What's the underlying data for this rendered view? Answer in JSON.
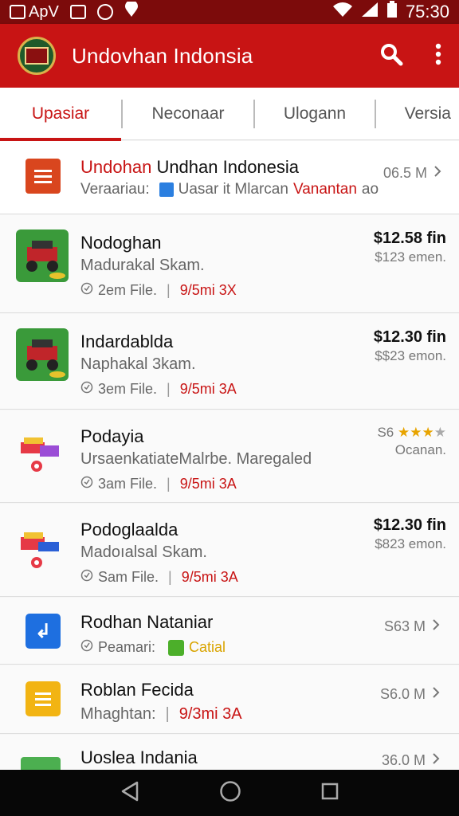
{
  "status_bar": {
    "app_label": "ApV",
    "time": "75:30"
  },
  "app_bar": {
    "title": "Undovhan Indonsia"
  },
  "tabs": [
    {
      "label": "Upasiar",
      "active": true
    },
    {
      "label": "Neconaar",
      "active": false
    },
    {
      "label": "Ulogann",
      "active": false
    },
    {
      "label": "Versia",
      "active": false
    }
  ],
  "featured": {
    "title_red": "Undohan",
    "title_rest": "Undhan Indonesia",
    "sub_label": "Veraariau:",
    "sub_text": "Uasar it Mlarcan",
    "sub_red": "Vanantan",
    "sub_tail": "ao",
    "size": "06.5 M"
  },
  "items": [
    {
      "title": "Nodoghan",
      "subtitle": "Madurakal Skam.",
      "meta_left": "2em File.",
      "meta_red": "9/5mi 3X",
      "price": "$12.58 fin",
      "price_sub": "$123 emen."
    },
    {
      "title": "Indardablda",
      "subtitle": "Naphakal 3kam.",
      "meta_left": "3em File.",
      "meta_red": "9/5mi 3A",
      "price": "$12.30 fin",
      "price_sub": "$$23 emon."
    },
    {
      "title": "Podayia",
      "subtitle": "UrsaenkatiateMalrbe. Maregaled",
      "meta_left": "3am File.",
      "meta_red": "9/5mi 3A",
      "rating_prefix": "S6",
      "rating_stars": 3,
      "price_sub": "Ocanan."
    },
    {
      "title": "Podoglaalda",
      "subtitle": "Madoıalsal Skam.",
      "meta_left": "Sam File.",
      "meta_red": "9/5mi 3A",
      "price": "$12.30 fin",
      "price_sub": "$823 emon."
    },
    {
      "title": "Rodhan Nataniar",
      "meta_left": "Peamari:",
      "meta_yellow": "Catial",
      "size": "S63 M"
    },
    {
      "title": "Roblan Fecida",
      "meta_left": "Mhaghtan:",
      "meta_red": "9/3mi 3A",
      "size": "S6.0 M"
    },
    {
      "title": "Uoslea Indania",
      "size": "36.0 M"
    }
  ],
  "colors": {
    "primary": "#c81414",
    "status_bar": "#7c0b0b",
    "nav_bar": "#070707",
    "accent_gold": "#d9a400"
  },
  "icons": [
    "image-icon",
    "photo-icon",
    "clock-icon",
    "location-icon",
    "wifi-icon",
    "signal-icon",
    "battery-icon",
    "search-icon",
    "more-vert-icon",
    "chevron-right-icon",
    "back-icon",
    "home-icon",
    "recents-icon"
  ]
}
